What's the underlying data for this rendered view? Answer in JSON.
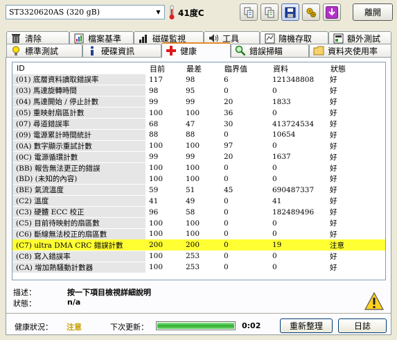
{
  "toolbar": {
    "drive": "ST3320620AS (320 gB)",
    "temperature": "41度C",
    "exit_label": "離開",
    "icons": [
      "copy-icon",
      "copy-all-icon",
      "save-icon",
      "options-icon",
      "down-arrow-icon"
    ]
  },
  "tabs_row1": [
    {
      "label": "清除",
      "icon": "trash-icon"
    },
    {
      "label": "檔案基準",
      "icon": "file-benchmark-icon"
    },
    {
      "label": "磁碟監視",
      "icon": "disk-monitor-icon"
    },
    {
      "label": "工具",
      "icon": "speaker-icon"
    },
    {
      "label": "隨機存取",
      "icon": "random-access-icon"
    },
    {
      "label": "額外測試",
      "icon": "extra-tests-icon"
    }
  ],
  "tabs_row2": [
    {
      "label": "標準測試",
      "icon": "bulb-icon"
    },
    {
      "label": "硬碟資訊",
      "icon": "info-icon"
    },
    {
      "label": "健康",
      "icon": "health-cross-icon"
    },
    {
      "label": "錯誤掃瞄",
      "icon": "magnifier-icon"
    },
    {
      "label": "資料夾使用率",
      "icon": "folder-icon"
    }
  ],
  "smart_table": {
    "headers": [
      "ID",
      "目前",
      "最差",
      "臨界值",
      "資料",
      "狀態"
    ],
    "rows": [
      [
        "(01) 底層資料讀取錯誤率",
        "117",
        "98",
        "6",
        "121348808",
        "好"
      ],
      [
        "(03) 馬達旋轉時間",
        "98",
        "95",
        "0",
        "0",
        "好"
      ],
      [
        "(04) 馬達開始 / 停止計數",
        "99",
        "99",
        "20",
        "1833",
        "好"
      ],
      [
        "(05) 重映射扇區計數",
        "100",
        "100",
        "36",
        "0",
        "好"
      ],
      [
        "(07) 尋道錯誤率",
        "68",
        "47",
        "30",
        "413724534",
        "好"
      ],
      [
        "(09) 電源累計時間統計",
        "88",
        "88",
        "0",
        "10654",
        "好"
      ],
      [
        "(0A) 數字顯示重試計數",
        "100",
        "100",
        "97",
        "0",
        "好"
      ],
      [
        "(0C) 電源循環計數",
        "99",
        "99",
        "20",
        "1637",
        "好"
      ],
      [
        "(BB) 報告無法更正的錯誤",
        "100",
        "100",
        "0",
        "0",
        "好"
      ],
      [
        "(BD) (未知的內容)",
        "100",
        "100",
        "0",
        "0",
        "好"
      ],
      [
        "(BE) 氣流溫度",
        "59",
        "51",
        "45",
        "690487337",
        "好"
      ],
      [
        "(C2) 溫度",
        "41",
        "49",
        "0",
        "41",
        "好"
      ],
      [
        "(C3) 硬體 ECC 校正",
        "96",
        "58",
        "0",
        "182489496",
        "好"
      ],
      [
        "(C5) 目前待映射的扇區數",
        "100",
        "100",
        "0",
        "0",
        "好"
      ],
      [
        "(C6) 斷線無法校正的扇區數",
        "100",
        "100",
        "0",
        "0",
        "好"
      ],
      [
        "(C7) ultra DMA CRC 錯誤計數",
        "200",
        "200",
        "0",
        "19",
        "注意"
      ],
      [
        "(C8) 寫入錯誤率",
        "100",
        "253",
        "0",
        "0",
        "好"
      ],
      [
        "(CA) 增加熱騷動計數器",
        "100",
        "253",
        "0",
        "0",
        "好"
      ]
    ],
    "highlight_row": 15,
    "highlight_color": "#ffff33"
  },
  "details": {
    "description_label": "描述：",
    "description_value": "按一下項目檢視詳細說明",
    "status_label": "狀態：",
    "status_value": "n/a"
  },
  "status_bar": {
    "health_label": "健康狀況：",
    "health_value": "注意",
    "next_update_label": "下次更新：",
    "progress": 1.0,
    "time": "0:02",
    "refresh_label": "重新整理",
    "log_label": "日誌"
  }
}
